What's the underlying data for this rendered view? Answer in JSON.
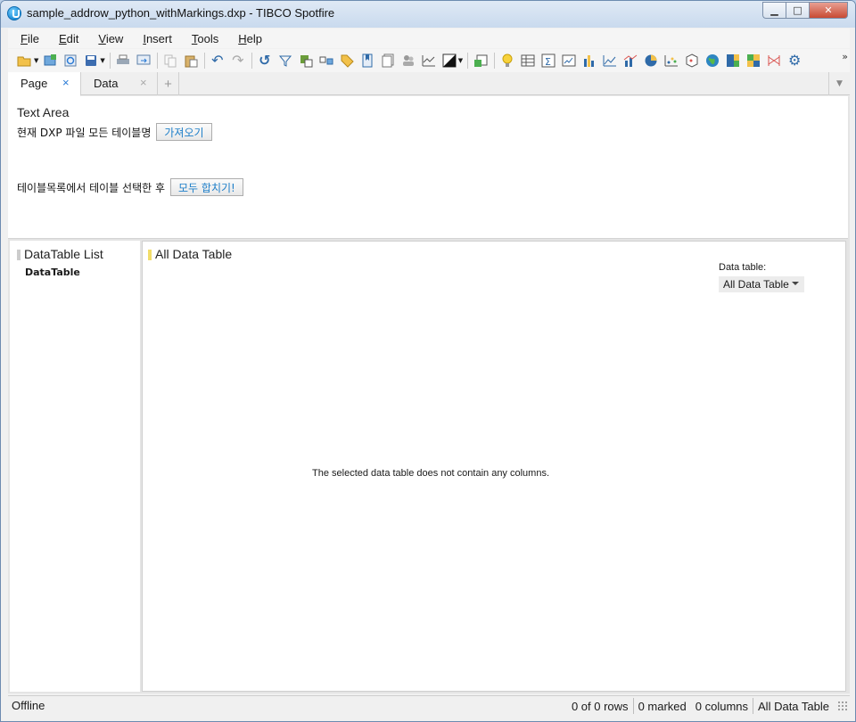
{
  "window": {
    "title": "sample_addrow_python_withMarkings.dxp - TIBCO Spotfire",
    "minimize": "▁",
    "maximize": "□",
    "close": "✕"
  },
  "menu": [
    {
      "label": "File",
      "key": "F",
      "rest": "ile"
    },
    {
      "label": "Edit",
      "key": "E",
      "rest": "dit"
    },
    {
      "label": "View",
      "key": "V",
      "rest": "iew"
    },
    {
      "label": "Insert",
      "key": "I",
      "rest": "nsert"
    },
    {
      "label": "Tools",
      "key": "T",
      "rest": "ools"
    },
    {
      "label": "Help",
      "key": "H",
      "rest": "elp"
    }
  ],
  "toolbar": {
    "icons": [
      "open-icon",
      "add-data-icon",
      "reload-icon",
      "save-icon",
      "print-icon",
      "export-icon",
      "copy-icon",
      "paste-icon",
      "undo-icon",
      "redo-icon",
      "reset-icon",
      "filter-icon",
      "details-icon",
      "relations-icon",
      "tag-icon",
      "bookmark-icon",
      "collection-icon",
      "user-icon",
      "chart-area-icon",
      "color-icon",
      "new-page-icon",
      "lightbulb-icon",
      "table-icon",
      "sum-icon",
      "graphical-table-icon",
      "bar-chart-icon",
      "line-chart-icon",
      "combo-chart-icon",
      "pie-chart-icon",
      "scatter-icon",
      "3d-scatter-icon",
      "map-icon",
      "treemap-icon",
      "heatmap-icon",
      "parallel-icon",
      "settings-icon"
    ],
    "more": "»"
  },
  "tabs": [
    {
      "label": "Page",
      "close": "×"
    },
    {
      "label": "Data",
      "close": "×"
    }
  ],
  "tab_add": "+",
  "text_area": {
    "title": "Text Area",
    "line1_label": "현재 DXP 파일 모든 테이블명",
    "line1_button": "가져오기",
    "line2_label": "테이블목록에서 테이블 선택한 후",
    "line2_button": "모두 합치기!"
  },
  "left_panel": {
    "title": "DataTable List",
    "item": "DataTable"
  },
  "main_panel": {
    "title": "All Data Table",
    "data_table_label": "Data table:",
    "data_table_value": "All Data Table",
    "empty_message": "The selected data table does not contain any columns."
  },
  "statusbar": {
    "left": "Offline",
    "rows": "0 of 0 rows",
    "marked": "0 marked",
    "columns": "0 columns",
    "table": "All Data Table"
  },
  "colors": {
    "accent_yellow": "#f2dd6a",
    "accent_gray": "#cccccc",
    "link_blue": "#1e7fc9"
  }
}
